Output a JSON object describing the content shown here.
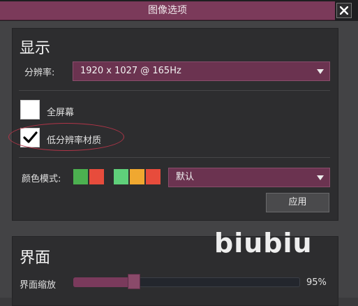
{
  "window": {
    "title": "图像选项"
  },
  "display_section": {
    "title": "显示",
    "resolution_label": "分辨率:",
    "resolution_value": "1920 x 1027 @ 165Hz",
    "fullscreen_label": "全屏幕",
    "fullscreen_checked": false,
    "low_res_textures_label": "低分辨率材质",
    "low_res_textures_checked": true,
    "color_mode_label": "颜色模式:",
    "color_mode_value": "默认",
    "apply_label": "应用"
  },
  "interface_section": {
    "title": "界面",
    "ui_scale_label": "界面缩放",
    "ui_scale_value": "95%",
    "ui_scale_fraction": 0.95
  },
  "color_swatches": {
    "group1": [
      "#4cb050",
      "#e74c3c"
    ],
    "group2": [
      "#5fd07a",
      "#f0a830",
      "#e74c3c"
    ]
  },
  "colors": {
    "accent": "#7b3a5a",
    "panel": "#2d2d2f",
    "highlight_ellipse": "#b03548"
  },
  "watermark": "biubiu",
  "icons": {
    "close": "close-icon",
    "checkmark": "checkmark-icon",
    "dropdown": "chevron-down-icon"
  }
}
